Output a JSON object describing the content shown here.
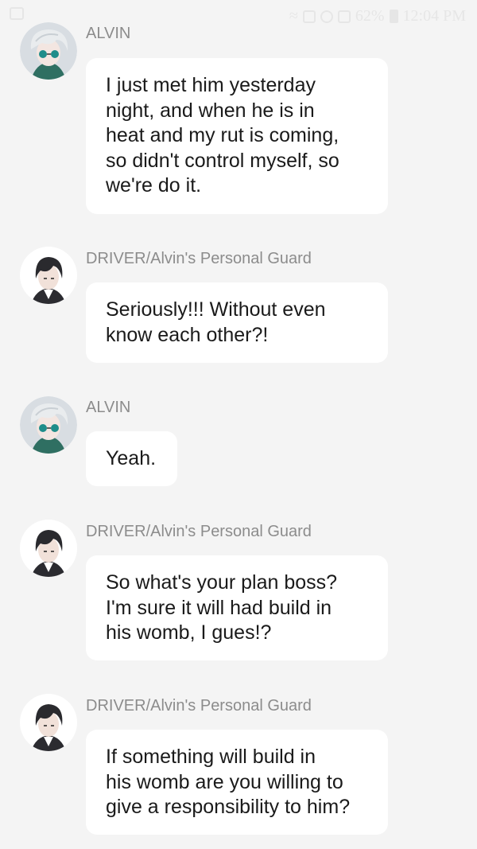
{
  "status_bar": {
    "battery": "62%",
    "time": "12:04 PM"
  },
  "messages": [
    {
      "sender": "ALVIN",
      "avatar": "alvin-avatar",
      "lines": [
        "I just met him yesterday",
        "night, and when he is in",
        "heat and my rut is coming,",
        "so didn't control myself, so",
        "we're do it."
      ]
    },
    {
      "sender": "DRIVER/Alvin's Personal Guard",
      "avatar": "driver-avatar",
      "lines": [
        "Seriously!!! Without even",
        "know each other?!"
      ]
    },
    {
      "sender": "ALVIN",
      "avatar": "alvin-avatar",
      "lines": [
        "Yeah."
      ]
    },
    {
      "sender": "DRIVER/Alvin's Personal Guard",
      "avatar": "driver-avatar",
      "lines": [
        "So what's your plan boss?",
        "I'm sure it will had build in",
        "his womb, I gues!?"
      ]
    },
    {
      "sender": "DRIVER/Alvin's Personal Guard",
      "avatar": "driver-avatar",
      "lines": [
        "If something will build in",
        "his womb are you willing to",
        "give a responsibility to him?"
      ]
    }
  ]
}
